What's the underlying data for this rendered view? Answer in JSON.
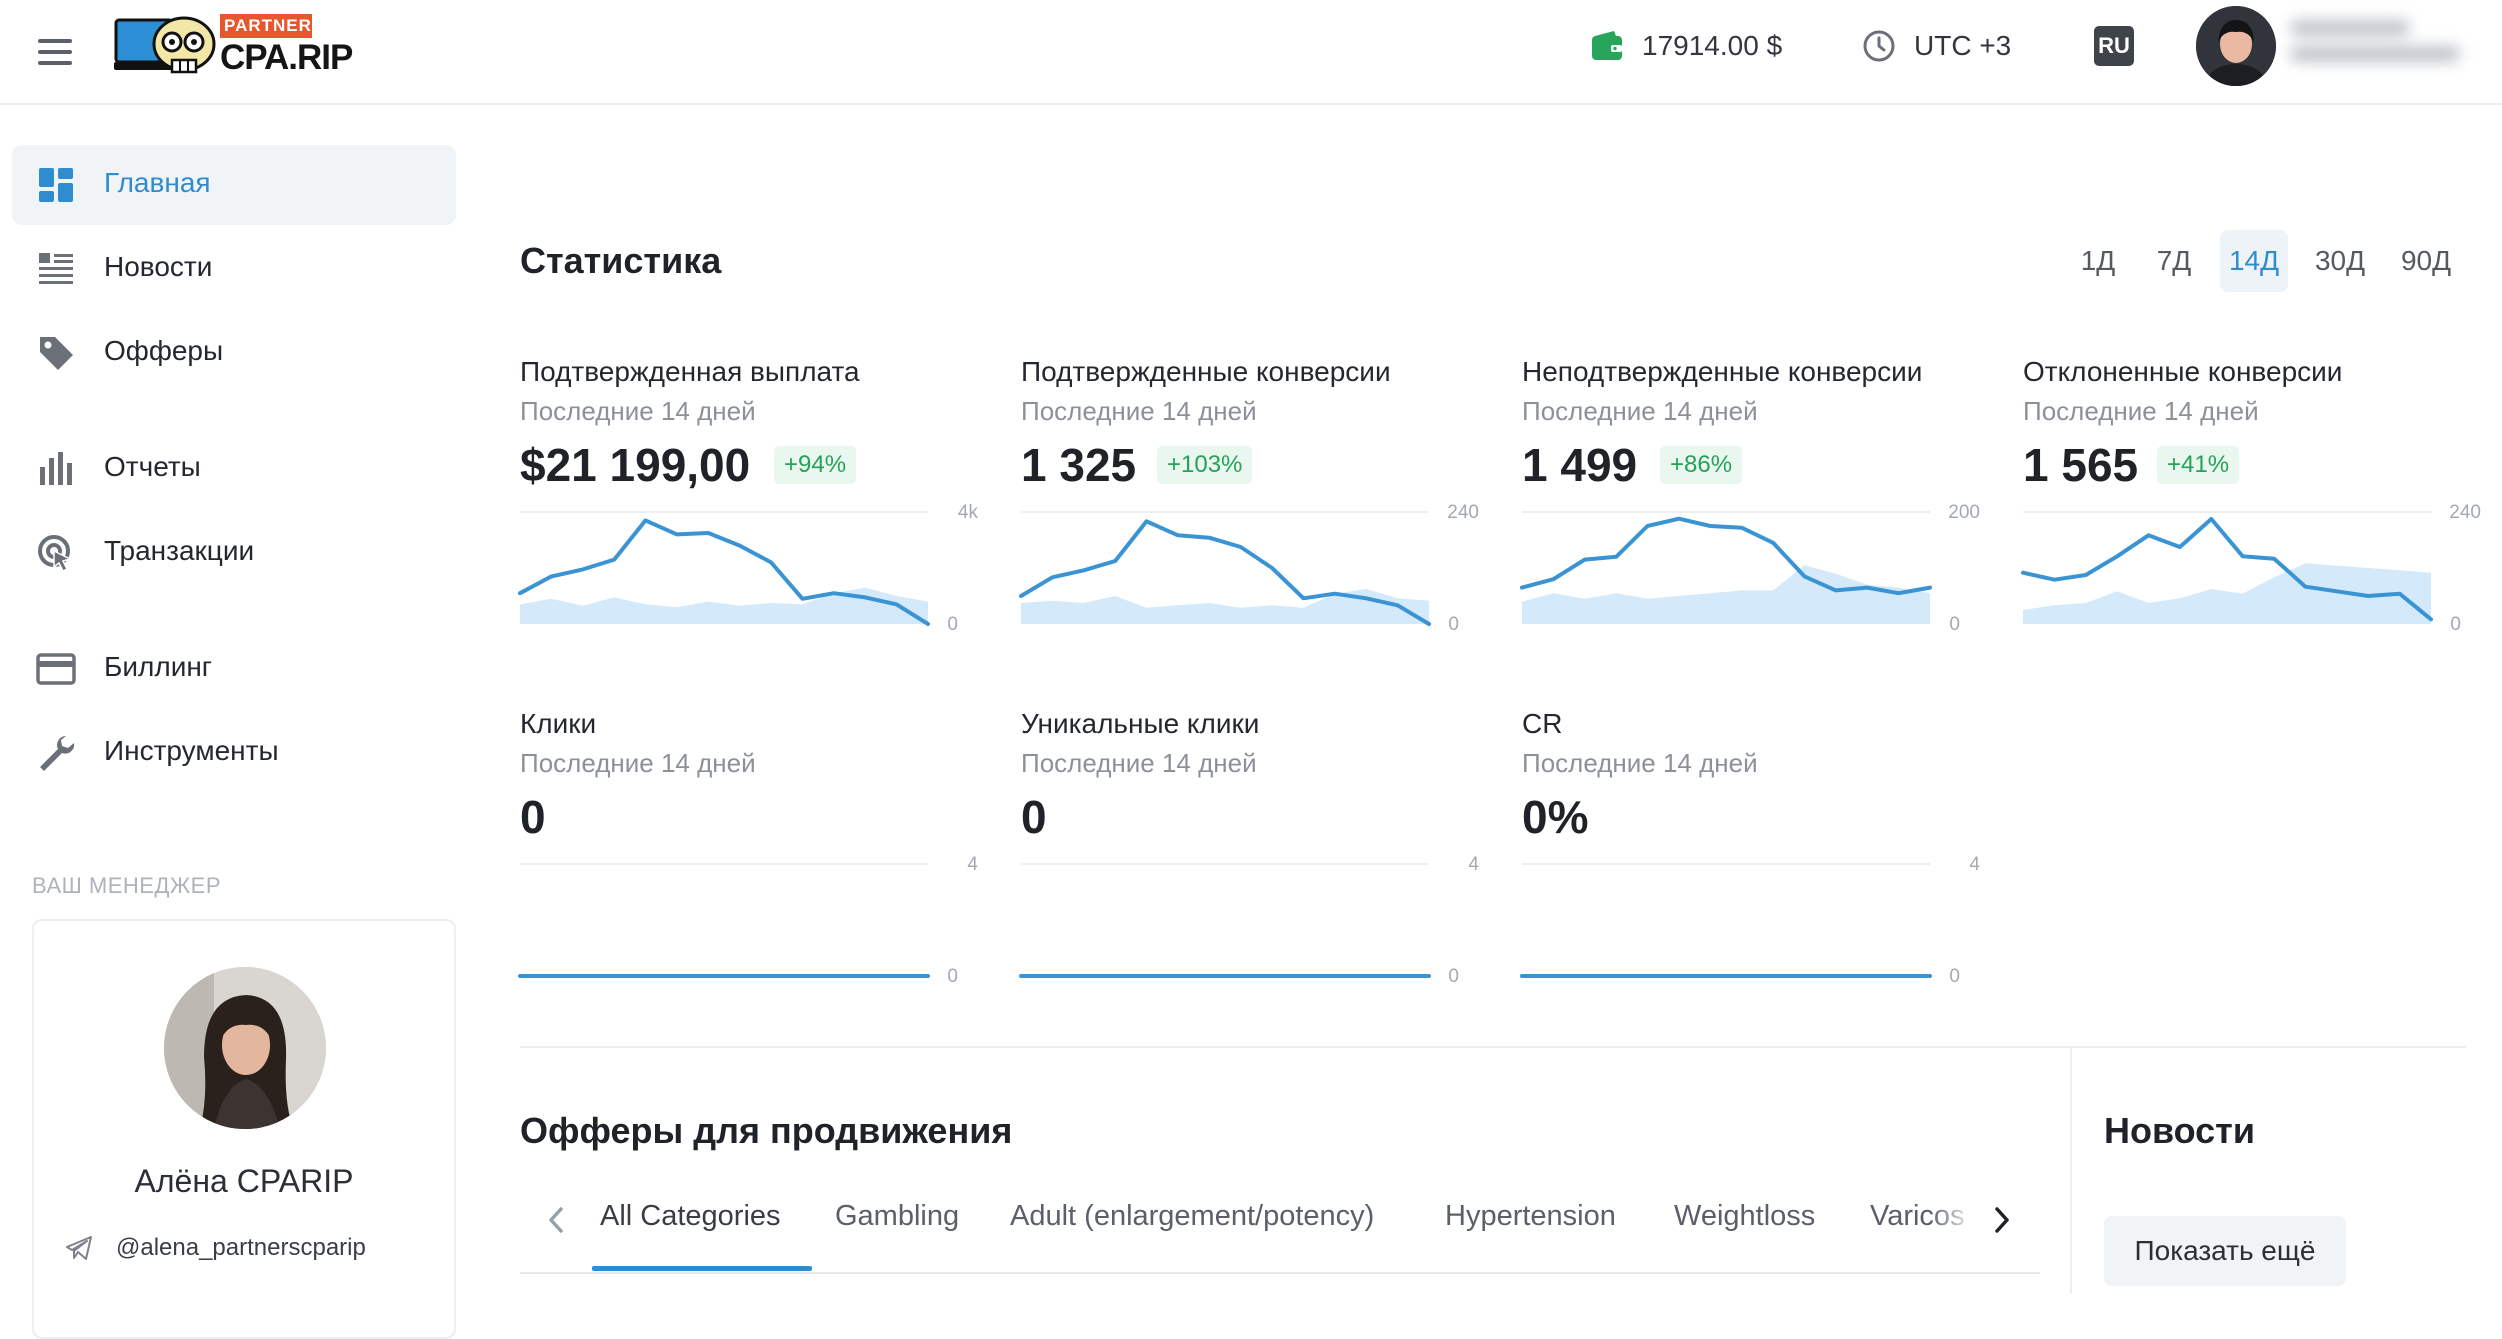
{
  "header": {
    "logo": {
      "top_label": "PARTNERS",
      "main_label": "CPA.RIP"
    },
    "balance": "17914.00 $",
    "timezone": "UTC +3",
    "language": "RU"
  },
  "sidebar": {
    "items": [
      {
        "label": "Главная",
        "icon": "dashboard-icon"
      },
      {
        "label": "Новости",
        "icon": "news-icon"
      },
      {
        "label": "Офферы",
        "icon": "tag-icon"
      },
      {
        "label": "Отчеты",
        "icon": "bar-chart-icon"
      },
      {
        "label": "Транзакции",
        "icon": "transactions-icon"
      },
      {
        "label": "Биллинг",
        "icon": "credit-card-icon"
      },
      {
        "label": "Инструменты",
        "icon": "wrench-icon"
      }
    ],
    "manager": {
      "heading": "ВАШ МЕНЕДЖЕР",
      "name": "Алёна CPARIP",
      "telegram": "@alena_partnerscparip"
    }
  },
  "stats": {
    "title": "Статистика",
    "periods": [
      "1Д",
      "7Д",
      "14Д",
      "30Д",
      "90Д"
    ],
    "active_period": "14Д",
    "cards": [
      {
        "title": "Подтвержденная выплата",
        "subtitle": "Последние 14 дней",
        "value": "$21 199,00",
        "change": "+94%"
      },
      {
        "title": "Подтвержденные конверсии",
        "subtitle": "Последние 14 дней",
        "value": "1 325",
        "change": "+103%"
      },
      {
        "title": "Неподтвержденные конверсии",
        "subtitle": "Последние 14 дней",
        "value": "1 499",
        "change": "+86%"
      },
      {
        "title": "Отклоненные конверсии",
        "subtitle": "Последние 14 дней",
        "value": "1 565",
        "change": "+41%"
      },
      {
        "title": "Клики",
        "subtitle": "Последние 14 дней",
        "value": "0"
      },
      {
        "title": "Уникальные клики",
        "subtitle": "Последние 14 дней",
        "value": "0"
      },
      {
        "title": "CR",
        "subtitle": "Последние 14 дней",
        "value": "0%"
      }
    ]
  },
  "chart_data": [
    {
      "type": "line",
      "ylim": [
        0,
        4000
      ],
      "y_tick_labels": [
        "4k",
        "0"
      ],
      "series": [
        {
          "values": [
            1100,
            1700,
            1950,
            2300,
            3700,
            3200,
            3250,
            2800,
            2200,
            900,
            1100,
            950,
            700,
            0
          ]
        },
        {
          "values": [
            700,
            900,
            650,
            950,
            700,
            600,
            800,
            650,
            750,
            700,
            1100,
            1300,
            1000,
            800
          ]
        }
      ]
    },
    {
      "type": "line",
      "ylim": [
        0,
        240
      ],
      "y_tick_labels": [
        "240",
        "0"
      ],
      "series": [
        {
          "values": [
            60,
            100,
            115,
            135,
            220,
            190,
            185,
            165,
            120,
            55,
            65,
            55,
            40,
            0
          ]
        },
        {
          "values": [
            45,
            50,
            45,
            60,
            35,
            40,
            45,
            35,
            40,
            35,
            65,
            75,
            55,
            50
          ]
        }
      ]
    },
    {
      "type": "line",
      "ylim": [
        0,
        200
      ],
      "y_tick_labels": [
        "200",
        "0"
      ],
      "series": [
        {
          "values": [
            65,
            80,
            115,
            120,
            175,
            188,
            175,
            172,
            145,
            85,
            60,
            65,
            55,
            65
          ]
        },
        {
          "values": [
            40,
            55,
            45,
            55,
            45,
            50,
            55,
            60,
            60,
            105,
            90,
            70,
            65,
            55
          ]
        }
      ]
    },
    {
      "type": "line",
      "ylim": [
        0,
        240
      ],
      "y_tick_labels": [
        "240",
        "0"
      ],
      "series": [
        {
          "values": [
            110,
            95,
            105,
            145,
            190,
            165,
            225,
            145,
            140,
            80,
            70,
            60,
            65,
            10
          ]
        },
        {
          "values": [
            30,
            40,
            45,
            70,
            45,
            55,
            75,
            65,
            100,
            130,
            125,
            120,
            115,
            110
          ]
        }
      ]
    },
    {
      "type": "line",
      "ylim": [
        0,
        4
      ],
      "y_tick_labels": [
        "4",
        "0"
      ],
      "series": [
        {
          "values": [
            0,
            0,
            0,
            0,
            0,
            0,
            0,
            0,
            0,
            0,
            0,
            0,
            0,
            0
          ]
        }
      ]
    },
    {
      "type": "line",
      "ylim": [
        0,
        4
      ],
      "y_tick_labels": [
        "4",
        "0"
      ],
      "series": [
        {
          "values": [
            0,
            0,
            0,
            0,
            0,
            0,
            0,
            0,
            0,
            0,
            0,
            0,
            0,
            0
          ]
        }
      ]
    },
    {
      "type": "line",
      "ylim": [
        0,
        4
      ],
      "y_tick_labels": [
        "4",
        "0"
      ],
      "series": [
        {
          "values": [
            0,
            0,
            0,
            0,
            0,
            0,
            0,
            0,
            0,
            0,
            0,
            0,
            0,
            0
          ]
        }
      ]
    }
  ],
  "offers": {
    "title": "Офферы для продвижения",
    "categories": [
      "All Categories",
      "Gambling",
      "Adult (enlargement/potency)",
      "Hypertension",
      "Weightloss",
      "Varicos"
    ],
    "active_category": "All Categories"
  },
  "news": {
    "title": "Новости",
    "show_more": "Показать ещё"
  },
  "colors": {
    "accent": "#2f8ccf",
    "line": "#3a94d4",
    "area": "#d4e9fa",
    "positive": "#25a25a",
    "logo_orange": "#e8562d",
    "wallet_green": "#27a55a"
  }
}
